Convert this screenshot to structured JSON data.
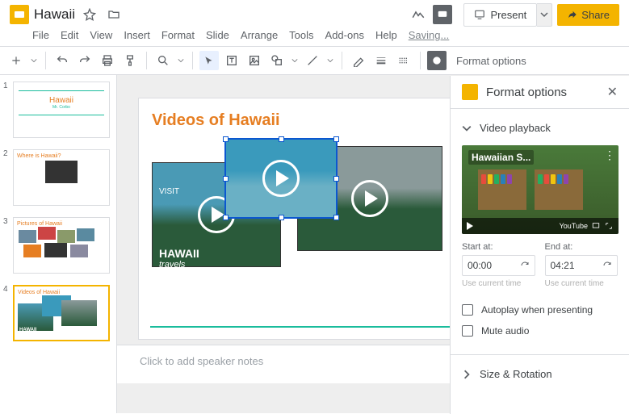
{
  "header": {
    "title": "Hawaii",
    "present": "Present",
    "share": "Share"
  },
  "menu": {
    "file": "File",
    "edit": "Edit",
    "view": "View",
    "insert": "Insert",
    "format": "Format",
    "slide": "Slide",
    "arrange": "Arrange",
    "tools": "Tools",
    "addons": "Add-ons",
    "help": "Help",
    "saving": "Saving..."
  },
  "toolbar": {
    "format_options": "Format options"
  },
  "thumbs": [
    {
      "n": "1",
      "title": "Hawaii",
      "subtitle": "Mr. Corbo"
    },
    {
      "n": "2",
      "title": "Where is Hawaii?"
    },
    {
      "n": "3",
      "title": "Pictures of Hawaii"
    },
    {
      "n": "4",
      "title": "Videos of Hawaii"
    }
  ],
  "slide": {
    "title": "Videos of Hawaii",
    "hawaii_visit": "VISIT",
    "hawaii_label": "HAWAII",
    "travels": "travels"
  },
  "notes": {
    "placeholder": "Click to add speaker notes"
  },
  "panel": {
    "title": "Format options",
    "video_playback": "Video playback",
    "preview_title": "Hawaiian S...",
    "youtube": "YouTube",
    "start_label": "Start at:",
    "start_value": "00:00",
    "start_hint": "Use current time",
    "end_label": "End at:",
    "end_value": "04:21",
    "end_hint": "Use current time",
    "autoplay": "Autoplay when presenting",
    "mute": "Mute audio",
    "size_rotation": "Size & Rotation"
  }
}
